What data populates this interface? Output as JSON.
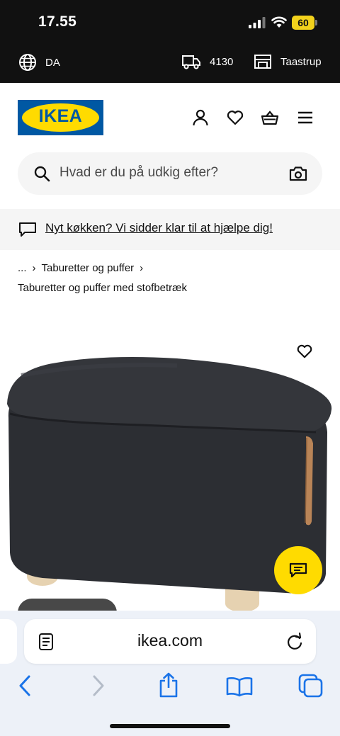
{
  "status": {
    "time": "17.55",
    "battery": "60"
  },
  "context_bar": {
    "language": "DA",
    "postcode": "4130",
    "store": "Taastrup"
  },
  "header": {
    "logo_text": "IKEA"
  },
  "search": {
    "placeholder": "Hvad er du på udkig efter?"
  },
  "banner": {
    "text": "Nyt køkken? Vi sidder klar til at hjælpe dig!"
  },
  "breadcrumb": {
    "ellipsis": "...",
    "sep": "›",
    "item": "Taburetter og puffer"
  },
  "subtitle": "Taburetter og puffer med stofbetræk",
  "browser": {
    "url": "ikea.com"
  },
  "colors": {
    "ikea_blue": "#0058a3",
    "ikea_yellow": "#ffdb00",
    "stool_fabric": "#2b2d31",
    "leather_handle": "#b98457",
    "wood_feet": "#e8d4b4"
  }
}
